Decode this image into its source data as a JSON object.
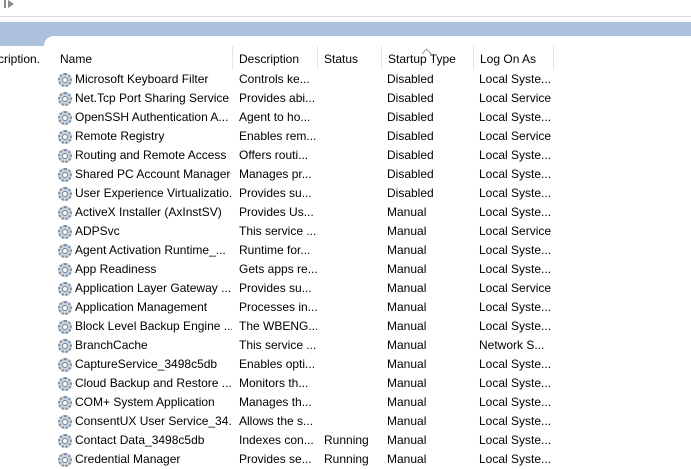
{
  "left_pane": {
    "description_fragment": "cription."
  },
  "columns": {
    "name": "Name",
    "description": "Description",
    "status": "Status",
    "startup_type": "Startup Type",
    "log_on_as": "Log On As"
  },
  "services": [
    {
      "name": "Microsoft Keyboard Filter",
      "description": "Controls ke...",
      "status": "",
      "startup": "Disabled",
      "logon": "Local Syste..."
    },
    {
      "name": "Net.Tcp Port Sharing Service",
      "description": "Provides abi...",
      "status": "",
      "startup": "Disabled",
      "logon": "Local Service"
    },
    {
      "name": "OpenSSH Authentication A...",
      "description": "Agent to ho...",
      "status": "",
      "startup": "Disabled",
      "logon": "Local Syste..."
    },
    {
      "name": "Remote Registry",
      "description": "Enables rem...",
      "status": "",
      "startup": "Disabled",
      "logon": "Local Service"
    },
    {
      "name": "Routing and Remote Access",
      "description": "Offers routi...",
      "status": "",
      "startup": "Disabled",
      "logon": "Local Syste..."
    },
    {
      "name": "Shared PC Account Manager",
      "description": "Manages pr...",
      "status": "",
      "startup": "Disabled",
      "logon": "Local Syste..."
    },
    {
      "name": "User Experience Virtualizatio...",
      "description": "Provides su...",
      "status": "",
      "startup": "Disabled",
      "logon": "Local Syste..."
    },
    {
      "name": "ActiveX Installer (AxInstSV)",
      "description": "Provides Us...",
      "status": "",
      "startup": "Manual",
      "logon": "Local Syste..."
    },
    {
      "name": "ADPSvc",
      "description": "This service ...",
      "status": "",
      "startup": "Manual",
      "logon": "Local Service"
    },
    {
      "name": "Agent Activation Runtime_...",
      "description": "Runtime for...",
      "status": "",
      "startup": "Manual",
      "logon": "Local Syste..."
    },
    {
      "name": "App Readiness",
      "description": "Gets apps re...",
      "status": "",
      "startup": "Manual",
      "logon": "Local Syste..."
    },
    {
      "name": "Application Layer Gateway ...",
      "description": "Provides su...",
      "status": "",
      "startup": "Manual",
      "logon": "Local Service"
    },
    {
      "name": "Application Management",
      "description": "Processes in...",
      "status": "",
      "startup": "Manual",
      "logon": "Local Syste..."
    },
    {
      "name": "Block Level Backup Engine ...",
      "description": "The WBENG...",
      "status": "",
      "startup": "Manual",
      "logon": "Local Syste..."
    },
    {
      "name": "BranchCache",
      "description": "This service ...",
      "status": "",
      "startup": "Manual",
      "logon": "Network S..."
    },
    {
      "name": "CaptureService_3498c5db",
      "description": "Enables opti...",
      "status": "",
      "startup": "Manual",
      "logon": "Local Syste..."
    },
    {
      "name": "Cloud Backup and Restore ...",
      "description": "Monitors th...",
      "status": "",
      "startup": "Manual",
      "logon": "Local Syste..."
    },
    {
      "name": "COM+ System Application",
      "description": "Manages th...",
      "status": "",
      "startup": "Manual",
      "logon": "Local Syste..."
    },
    {
      "name": "ConsentUX User Service_34...",
      "description": "Allows the s...",
      "status": "",
      "startup": "Manual",
      "logon": "Local Syste..."
    },
    {
      "name": "Contact Data_3498c5db",
      "description": "Indexes con...",
      "status": "Running",
      "startup": "Manual",
      "logon": "Local Syste..."
    },
    {
      "name": "Credential Manager",
      "description": "Provides se...",
      "status": "Running",
      "startup": "Manual",
      "logon": "Local Syste..."
    }
  ],
  "colors": {
    "accent_bar": "#abc1de",
    "gear": "#7d8c9e"
  },
  "icons": {
    "row_icon": "gear-icon",
    "toolbar_icon": "play-icon"
  }
}
